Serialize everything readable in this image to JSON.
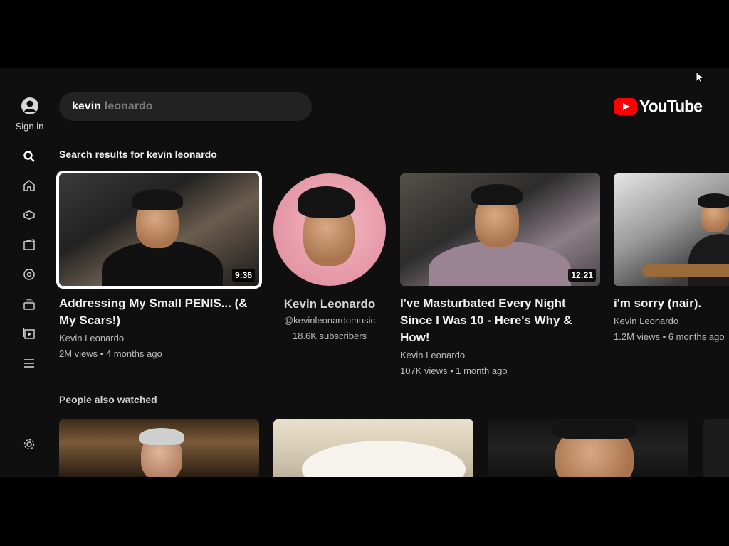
{
  "sidebar": {
    "signin_label": "Sign in",
    "icons": [
      "search-icon",
      "home-icon",
      "gaming-icon",
      "movies-icon",
      "music-icon",
      "subscriptions-icon",
      "library-icon",
      "menu-icon",
      "settings-icon"
    ]
  },
  "search": {
    "typed": "kevin",
    "suggestion": "leonardo"
  },
  "logo": {
    "text": "YouTube",
    "color": "#ff0000"
  },
  "results": {
    "heading": "Search results for kevin leonardo",
    "video1": {
      "title": "Addressing My Small PENIS... (& My Scars!)",
      "channel": "Kevin Leonardo",
      "stats": "2M views • 4 months ago",
      "duration": "9:36"
    },
    "channel": {
      "name": "Kevin Leonardo",
      "handle": "@kevinleonardomusic",
      "subscribers": "18.6K subscribers"
    },
    "video2": {
      "title": "I've Masturbated Every Night Since I Was 10 - Here's Why & How!",
      "channel": "Kevin Leonardo",
      "stats": "107K views • 1 month ago",
      "duration": "12:21"
    },
    "video3": {
      "title": "i'm sorry (nair).",
      "channel": "Kevin Leonardo",
      "stats": "1.2M views • 6 months ago"
    }
  },
  "also_watched": {
    "heading": "People also watched"
  }
}
